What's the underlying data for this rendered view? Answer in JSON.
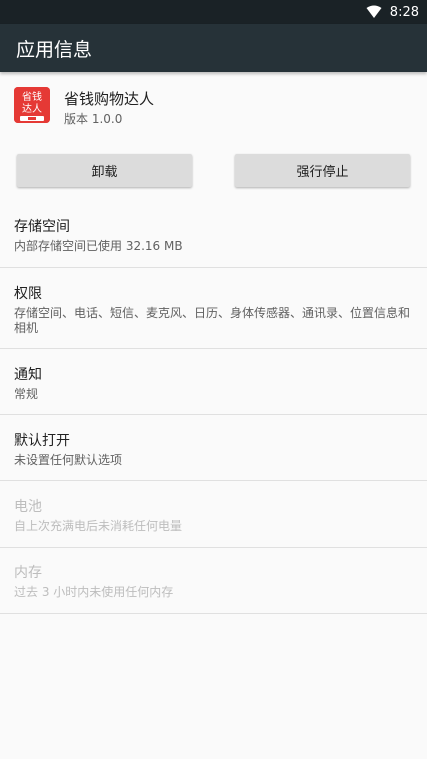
{
  "status_bar": {
    "time": "8:28",
    "wifi_icon": "wifi-icon"
  },
  "app_bar": {
    "title": "应用信息"
  },
  "app": {
    "icon": "app-icon",
    "icon_text_top": "省钱",
    "icon_text_bottom": "达人",
    "name": "省钱购物达人",
    "version": "版本 1.0.0"
  },
  "buttons": {
    "uninstall": "卸载",
    "force_stop": "强行停止"
  },
  "sections": [
    {
      "title": "存储空间",
      "sub": "内部存储空间已使用 32.16 MB"
    },
    {
      "title": "权限",
      "sub": "存储空间、电话、短信、麦克风、日历、身体传感器、通讯录、位置信息和相机"
    },
    {
      "title": "通知",
      "sub": "常规"
    },
    {
      "title": "默认打开",
      "sub": "未设置任何默认选项"
    },
    {
      "title": "电池",
      "sub": "自上次充满电后未消耗任何电量"
    },
    {
      "title": "内存",
      "sub": "过去 3 小时内未使用任何内存"
    }
  ]
}
